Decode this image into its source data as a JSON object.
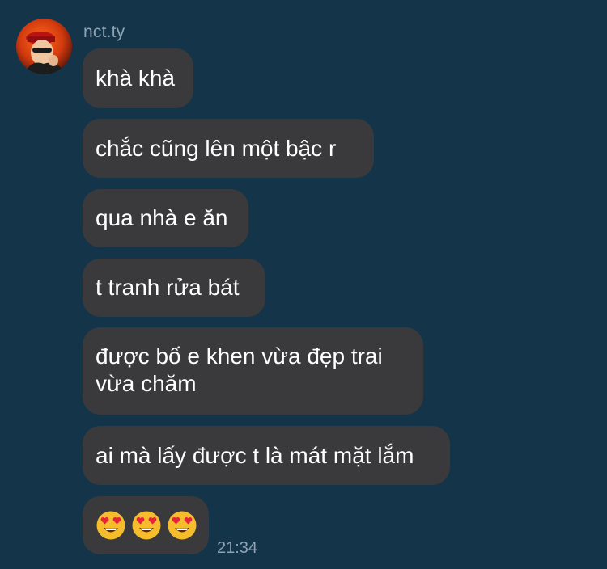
{
  "chat": {
    "sender_name": "nct.ty",
    "messages": [
      {
        "text": "khà khà"
      },
      {
        "text": "chắc cũng lên một bậc r"
      },
      {
        "text": "qua nhà e ăn"
      },
      {
        "text": "t tranh rửa bát"
      },
      {
        "lines": [
          "được bố e khen vừa đẹp trai",
          "vừa chăm"
        ]
      },
      {
        "text": "ai mà lấy được t là mát mặt lắm"
      },
      {
        "emojis": [
          "heart-eyes-emoji",
          "heart-eyes-emoji",
          "heart-eyes-emoji"
        ]
      }
    ],
    "timestamp": "21:34"
  },
  "colors": {
    "background": "#14344a",
    "bubble": "#3a3a3c",
    "muted_text": "#8ea3b3",
    "emoji_face": "#f5bd2b",
    "emoji_heart": "#e8213f"
  }
}
